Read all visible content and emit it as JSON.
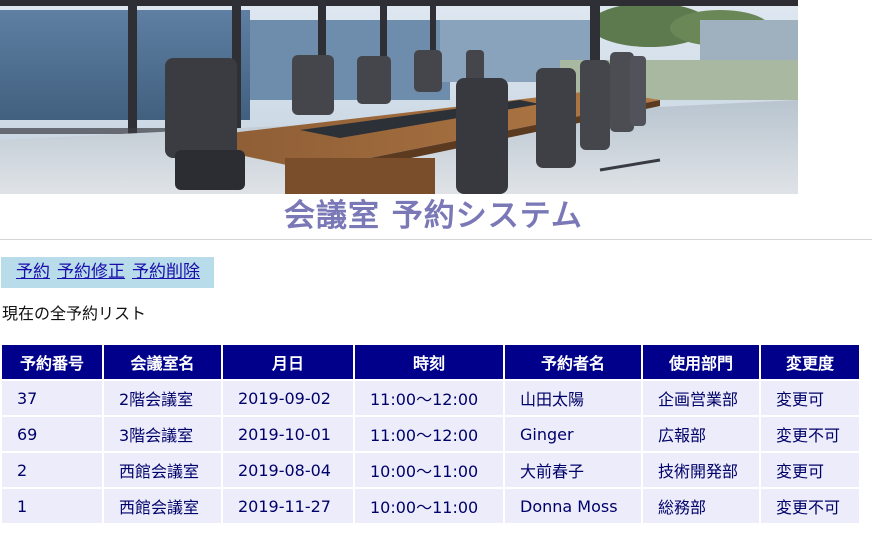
{
  "header": {
    "title": "会議室 予約システム"
  },
  "nav": {
    "links": [
      "予約",
      "予約修正",
      "予約削除"
    ]
  },
  "list": {
    "heading": "現在の全予約リスト",
    "columns": [
      "予約番号",
      "会議室名",
      "月日",
      "時刻",
      "予約者名",
      "使用部門",
      "変更度"
    ],
    "rows": [
      [
        "37",
        "2階会議室",
        "2019-09-02",
        "11:00〜12:00",
        "山田太陽",
        "企画営業部",
        "変更可"
      ],
      [
        "69",
        "3階会議室",
        "2019-10-01",
        "11:00〜12:00",
        "Ginger",
        "広報部",
        "変更不可"
      ],
      [
        "2",
        "西館会議室",
        "2019-08-04",
        "10:00〜11:00",
        "大前春子",
        "技術開発部",
        "変更可"
      ],
      [
        "1",
        "西館会議室",
        "2019-11-27",
        "10:00〜11:00",
        "Donna Moss",
        "総務部",
        "変更不可"
      ]
    ]
  },
  "colors": {
    "title": "#7a78b6",
    "nav_bg": "#b8dcea",
    "header_bg": "#00008b",
    "cell_bg": "#ececfa",
    "link": "#1a0dab"
  }
}
